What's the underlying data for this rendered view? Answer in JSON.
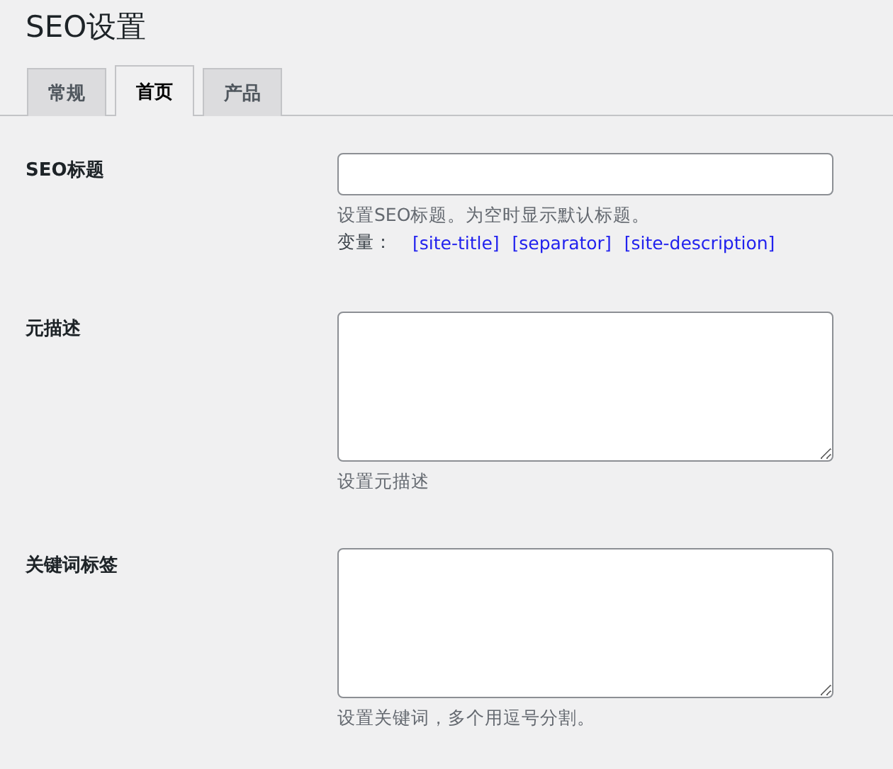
{
  "page_title": "SEO设置",
  "tabs": [
    {
      "label": "常规",
      "selected": false
    },
    {
      "label": "首页",
      "selected": true
    },
    {
      "label": "产品",
      "selected": false
    }
  ],
  "fields": [
    {
      "label": "SEO标题",
      "kind": "input",
      "help": "设置SEO标题。为空时显示默认标题。",
      "variables_label": "变量：",
      "variables": [
        "[site-title]",
        "[separator]",
        "[site-description]"
      ]
    },
    {
      "label": "元描述",
      "kind": "textarea",
      "help": "设置元描述"
    },
    {
      "label": "关键词标签",
      "kind": "textarea",
      "help": "设置关键词，多个用逗号分割。"
    }
  ]
}
